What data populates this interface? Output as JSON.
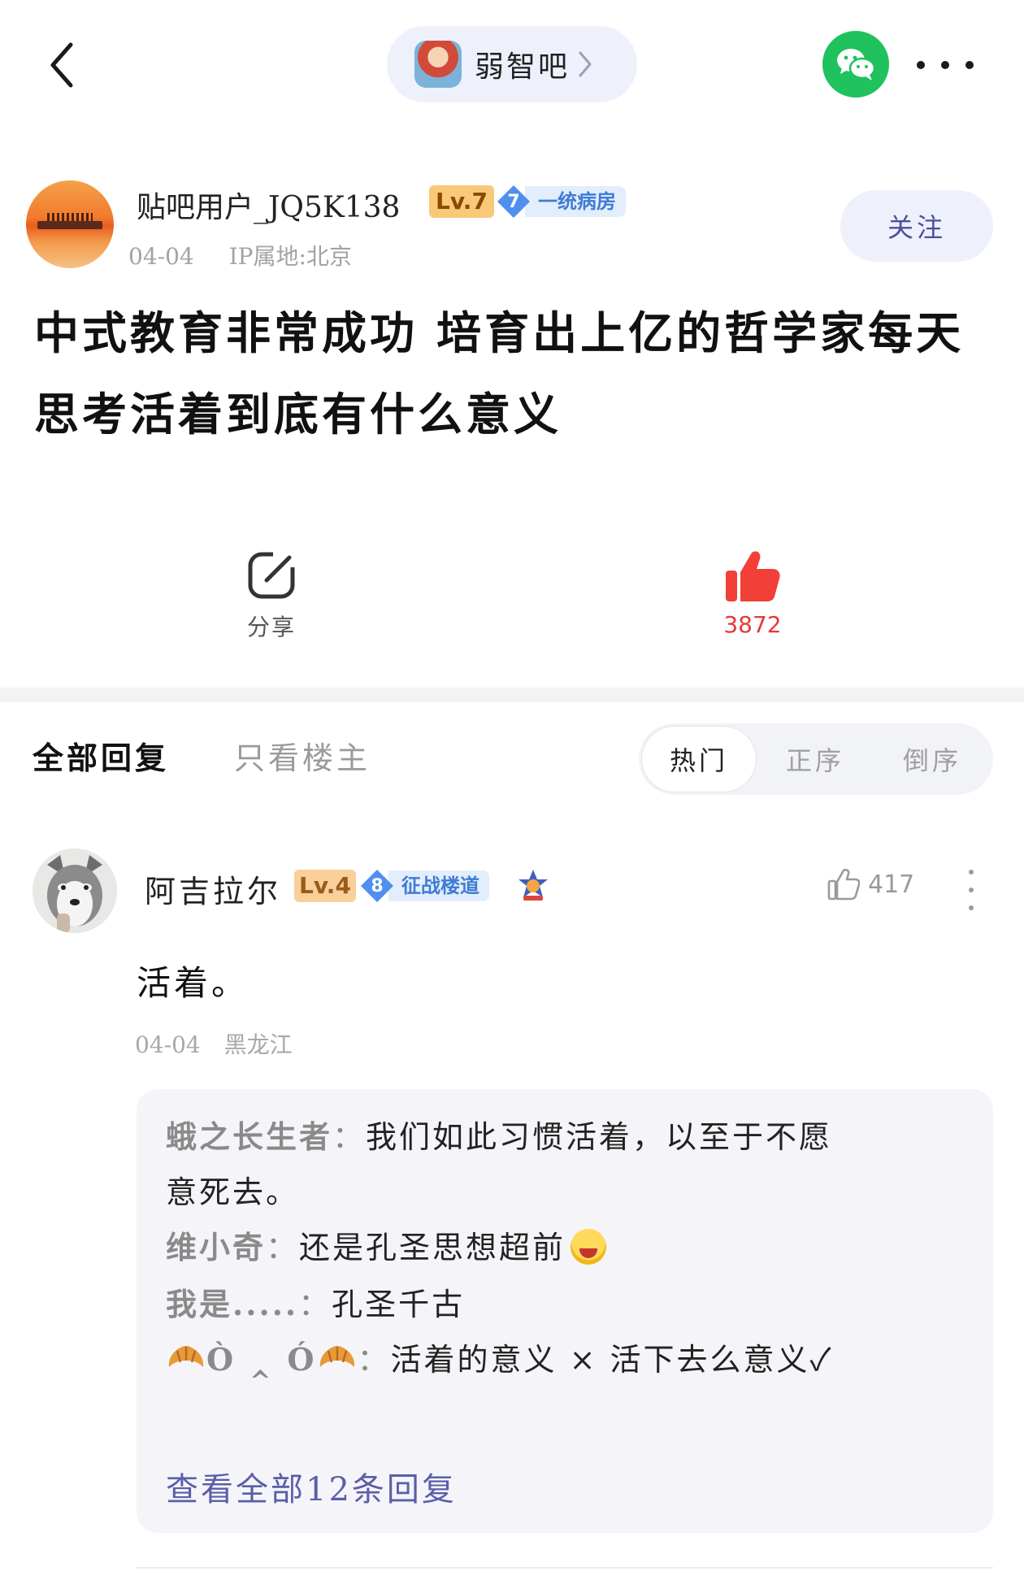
{
  "topbar": {
    "forum_name": "弱智吧"
  },
  "author": {
    "name": "贴吧用户_JQ5K138",
    "level": "Lv.7",
    "group_level": "7",
    "group_name": "一统病房",
    "date": "04-04",
    "ip_location": "IP属地:北京",
    "follow_label": "关注"
  },
  "post": {
    "title": "中式教育非常成功 培育出上亿的哲学家每天思考活着到底有什么意义",
    "share_label": "分享",
    "like_count": "3872"
  },
  "reply_tabs": {
    "all": "全部回复",
    "op_only": "只看楼主",
    "sort_hot": "热门",
    "sort_asc": "正序",
    "sort_desc": "倒序",
    "selected_sort": "热门"
  },
  "comment": {
    "name": "阿吉拉尔",
    "level": "Lv.4",
    "group_level": "8",
    "group_name": "征战楼道",
    "likes": "417",
    "text": "活着。",
    "date": "04-04",
    "location": "黑龙江",
    "sub_replies": [
      {
        "name": "蛾之长生者",
        "text_line1": "我们如此习惯活着，以至于不愿",
        "text_line2": "意死去。"
      },
      {
        "name": "维小奇",
        "text": "还是孔圣思想超前",
        "emoji": "laughing-face-icon"
      },
      {
        "name": "我是.....",
        "text": "孔圣千古"
      },
      {
        "name": "Ò ‸ Ó",
        "text": "活着的意义 × 活下去么意义✓",
        "name_decor": "croissant-icon"
      }
    ],
    "view_all_label": "查看全部12条回复"
  },
  "colors": {
    "wechat_green": "#1fc25c",
    "like_red": "#e53935",
    "link_purple": "#5b5ea8"
  }
}
